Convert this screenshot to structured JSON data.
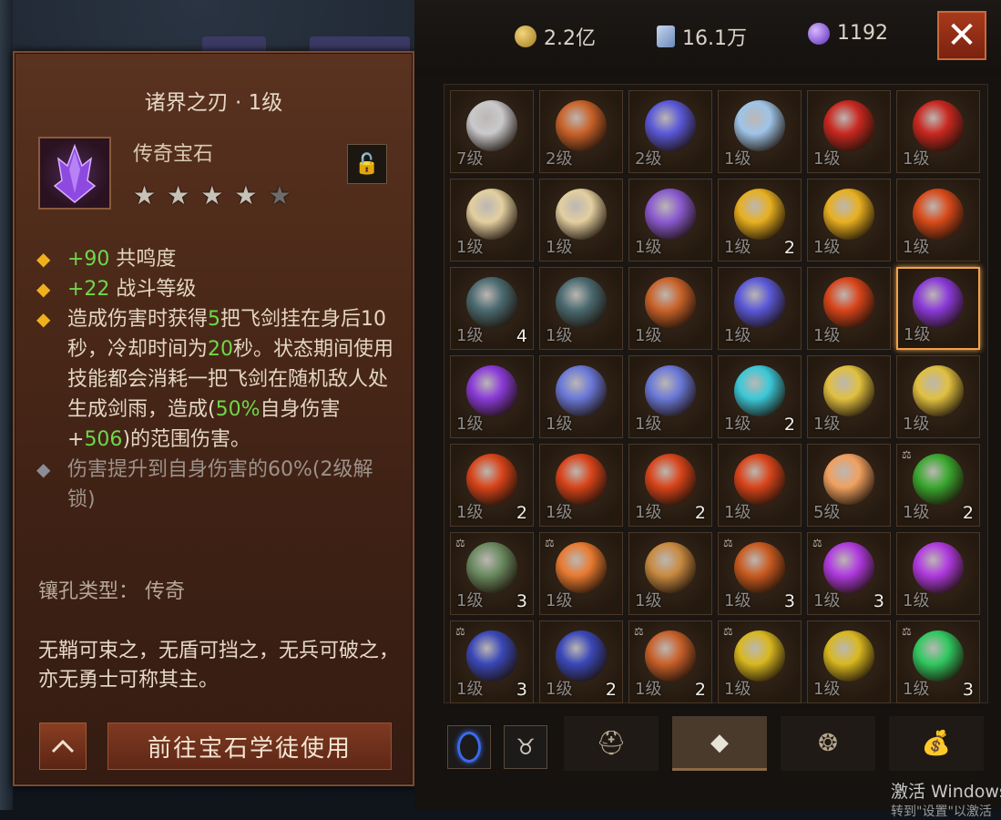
{
  "tooltip": {
    "title": "诸界之刃 · 1级",
    "gem_type": "传奇宝石",
    "stars": [
      true,
      true,
      true,
      true,
      false
    ],
    "bonus1_value": "+90",
    "bonus1_label": " 共鸣度",
    "bonus2_value": "+22",
    "bonus2_label": " 战斗等级",
    "effect": {
      "p1": "造成伤害时获得",
      "n1": "5",
      "p2": "把飞剑挂在身后10秒，冷却时间为",
      "n2": "20",
      "p3": "秒。状态期间使用技能都会消耗一把飞剑在随机敌人处生成剑雨，造成(",
      "n3": "50%",
      "p4": "自身伤害+",
      "n4": "506",
      "p5": ")的范围伤害。"
    },
    "locked_effect": "伤害提升到自身伤害的60%(2级解锁)",
    "socket_type": "镶孔类型：  传奇",
    "lore": "无鞘可束之，无盾可挡之，无兵可破之，亦无勇士可称其主。",
    "go_button": "前往宝石学徒使用",
    "up_icon": "^",
    "lock_icon": "🔓"
  },
  "currency": {
    "gold": "2.2亿",
    "platinum": "16.1万",
    "orbs": "1192"
  },
  "close_label": "✕",
  "gems": [
    {
      "lvl": "7级",
      "count": "",
      "lock": false,
      "color": "#c9c9cc"
    },
    {
      "lvl": "2级",
      "count": "",
      "lock": false,
      "color": "#c9622a"
    },
    {
      "lvl": "2级",
      "count": "",
      "lock": false,
      "color": "#5a58d8"
    },
    {
      "lvl": "1级",
      "count": "",
      "lock": false,
      "color": "#9fc4e8"
    },
    {
      "lvl": "1级",
      "count": "",
      "lock": false,
      "color": "#c82820"
    },
    {
      "lvl": "1级",
      "count": "",
      "lock": false,
      "color": "#c82820"
    },
    {
      "lvl": "1级",
      "count": "",
      "lock": false,
      "color": "#e3cfa0"
    },
    {
      "lvl": "1级",
      "count": "",
      "lock": false,
      "color": "#e3cfa0"
    },
    {
      "lvl": "1级",
      "count": "",
      "lock": false,
      "color": "#8a5ad0"
    },
    {
      "lvl": "1级",
      "count": "2",
      "lock": false,
      "color": "#e8b020"
    },
    {
      "lvl": "1级",
      "count": "",
      "lock": false,
      "color": "#e8b020"
    },
    {
      "lvl": "1级",
      "count": "",
      "lock": false,
      "color": "#d84a1a"
    },
    {
      "lvl": "1级",
      "count": "4",
      "lock": false,
      "color": "#4a6a70"
    },
    {
      "lvl": "1级",
      "count": "",
      "lock": false,
      "color": "#4a6a70"
    },
    {
      "lvl": "1级",
      "count": "",
      "lock": false,
      "color": "#c9622a"
    },
    {
      "lvl": "1级",
      "count": "",
      "lock": false,
      "color": "#5a58d8"
    },
    {
      "lvl": "1级",
      "count": "",
      "lock": false,
      "color": "#d8441a"
    },
    {
      "lvl": "1级",
      "count": "",
      "lock": false,
      "color": "#8a3ad8",
      "selected": true
    },
    {
      "lvl": "1级",
      "count": "",
      "lock": false,
      "color": "#8a3ad8"
    },
    {
      "lvl": "1级",
      "count": "",
      "lock": false,
      "color": "#6a78d8"
    },
    {
      "lvl": "1级",
      "count": "",
      "lock": false,
      "color": "#6a78d8"
    },
    {
      "lvl": "1级",
      "count": "2",
      "lock": false,
      "color": "#3ac8d8"
    },
    {
      "lvl": "1级",
      "count": "",
      "lock": false,
      "color": "#e0c040"
    },
    {
      "lvl": "1级",
      "count": "",
      "lock": false,
      "color": "#e0c040"
    },
    {
      "lvl": "1级",
      "count": "2",
      "lock": false,
      "color": "#d8441a"
    },
    {
      "lvl": "1级",
      "count": "",
      "lock": false,
      "color": "#d8441a"
    },
    {
      "lvl": "1级",
      "count": "2",
      "lock": false,
      "color": "#d8441a"
    },
    {
      "lvl": "1级",
      "count": "",
      "lock": false,
      "color": "#d8441a"
    },
    {
      "lvl": "5级",
      "count": "",
      "lock": false,
      "color": "#f0a060"
    },
    {
      "lvl": "1级",
      "count": "2",
      "lock": true,
      "color": "#3aa830"
    },
    {
      "lvl": "1级",
      "count": "3",
      "lock": true,
      "color": "#6a8a60"
    },
    {
      "lvl": "1级",
      "count": "",
      "lock": true,
      "color": "#e87a30"
    },
    {
      "lvl": "1级",
      "count": "",
      "lock": false,
      "color": "#c88a40"
    },
    {
      "lvl": "1级",
      "count": "3",
      "lock": true,
      "color": "#c85a20"
    },
    {
      "lvl": "1级",
      "count": "3",
      "lock": true,
      "color": "#b03ae0"
    },
    {
      "lvl": "1级",
      "count": "",
      "lock": false,
      "color": "#b03ae0"
    },
    {
      "lvl": "1级",
      "count": "3",
      "lock": true,
      "color": "#3a48b8"
    },
    {
      "lvl": "1级",
      "count": "2",
      "lock": false,
      "color": "#3a48b8"
    },
    {
      "lvl": "1级",
      "count": "2",
      "lock": true,
      "color": "#c8602a"
    },
    {
      "lvl": "1级",
      "count": "",
      "lock": true,
      "color": "#d8b820"
    },
    {
      "lvl": "1级",
      "count": "",
      "lock": false,
      "color": "#d8b820"
    },
    {
      "lvl": "1级",
      "count": "3",
      "lock": true,
      "color": "#30c860"
    }
  ],
  "tabs": [
    "⛑",
    "🧤",
    "❂",
    "💰"
  ],
  "watermark": "激活 Windows",
  "watermark2": "转到\"设置\"以激活"
}
